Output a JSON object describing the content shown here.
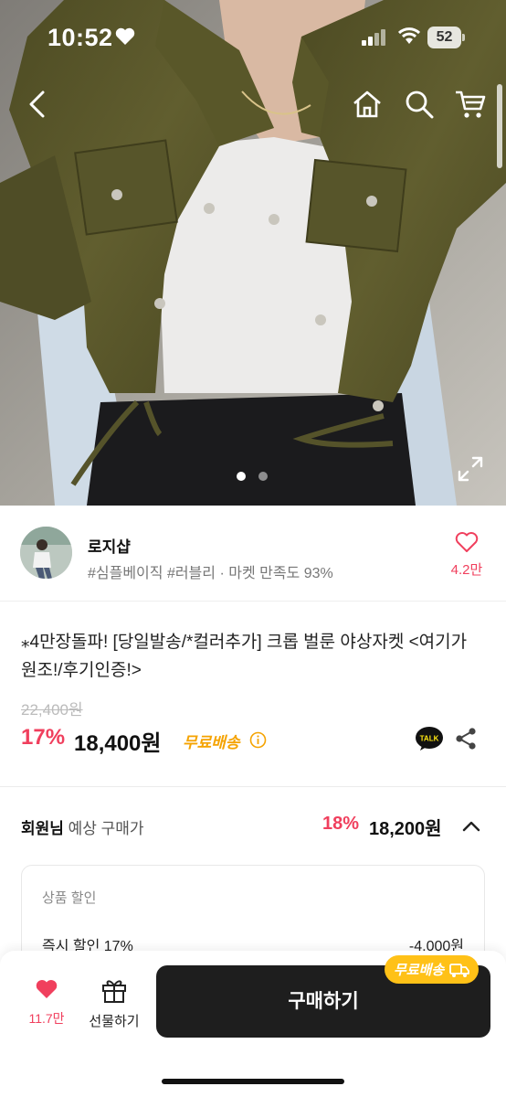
{
  "status_bar": {
    "time": "10:52",
    "battery": "52",
    "icons": [
      "heart-icon",
      "signal-icon",
      "wifi-icon",
      "battery-icon"
    ]
  },
  "top_nav": {
    "icons": [
      "chevron-left-icon",
      "home-icon",
      "search-icon",
      "cart-icon"
    ]
  },
  "gallery": {
    "total_images": 2,
    "current_index": 1,
    "icons": [
      "expand-icon"
    ]
  },
  "seller": {
    "name": "로지샵",
    "meta": "#심플베이직 #러블리 · 마켓 만족도 93%",
    "likes": "4.2만"
  },
  "product": {
    "title": "⁎4만장돌파! [당일발송/*컬러추가] 크롭 벌룬 야상자켓 <여기가 원조!/후기인증!>",
    "original_price": "22,400원",
    "discount_percent": "17%",
    "price": "18,400원",
    "free_shipping": "무료배송"
  },
  "member_price": {
    "label_bold": "회원님",
    "label_rest": " 예상 구매가",
    "discount_percent": "18%",
    "price": "18,200원"
  },
  "discount_box": {
    "header": "상품 할인",
    "row_label": "즉시 할인 17%",
    "row_value": "-4,000원"
  },
  "bottom_bar": {
    "wish_count": "11.7만",
    "gift_label": "선물하기",
    "buy_label": "구매하기",
    "ship_badge": "무료배송"
  },
  "colors": {
    "accent_pink": "#f03f5d",
    "free_ship_orange": "#f5a300",
    "badge_yellow": "#ffc117",
    "buy_button": "#1e1e1e",
    "jacket_olive": "#5d5a2c"
  }
}
